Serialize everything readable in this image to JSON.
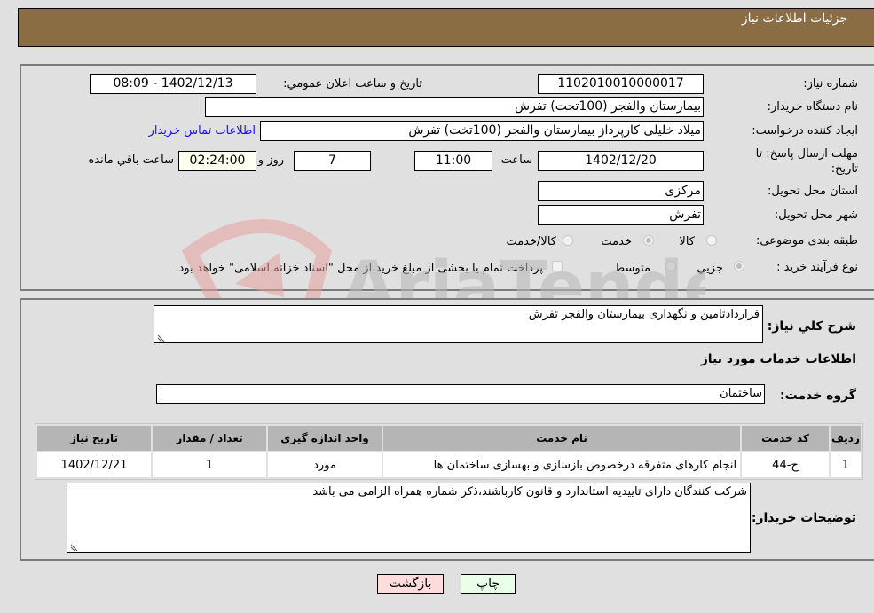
{
  "header": {
    "title": "جزئیات اطلاعات نیاز"
  },
  "fields": {
    "need_number": {
      "label": "شماره نیاز:",
      "value": "1102010010000017"
    },
    "announce_datetime": {
      "label": "تاریخ و ساعت اعلان عمومي:",
      "value": "1402/12/13 - 08:09"
    },
    "buyer_org": {
      "label": "نام دستگاه خریدار:",
      "value": "بیمارستان والفجر (100تخت) تفرش"
    },
    "requester": {
      "label": "ایجاد کننده درخواست:",
      "value": "میلاد خلیلی کارپرداز بیمارستان والفجر (100تخت) تفرش"
    },
    "contact_link": "اطلاعات تماس خریدار",
    "deadline": {
      "label_line1": "مهلت ارسال پاسخ: تا",
      "label_line2": "تاریخ:",
      "date": "1402/12/20",
      "time_label": "ساعت",
      "time": "11:00",
      "days": "7",
      "days_label": "روز و",
      "remaining": "02:24:00",
      "remaining_label": "ساعت باقي مانده"
    },
    "province": {
      "label": "استان محل تحویل:",
      "value": "مرکزی"
    },
    "city": {
      "label": "شهر محل تحویل:",
      "value": "تفرش"
    },
    "category": {
      "label": "طبقه بندی موضوعی:",
      "options": [
        "کالا",
        "خدمت",
        "کالا/خدمت"
      ],
      "selected": "خدمت"
    },
    "purchase_type": {
      "label": "نوع فرآیند خرید :",
      "options": [
        "جزیي",
        "متوسط"
      ],
      "selected": "جزیي",
      "treasury_note": "پرداخت تمام یا بخشی از مبلغ خرید،از محل \"اسناد خزانه اسلامی\" خواهد بود."
    }
  },
  "description": {
    "label": "شرح کلي نیاز:",
    "value": "قراردادتامین و نگهداری بیمارستان والفجر تفرش"
  },
  "services_section": {
    "title": "اطلاعات خدمات مورد نیاز",
    "group_label": "گروه خدمت:",
    "group_value": "ساختمان",
    "table": {
      "headers": [
        "ردیف",
        "کد خدمت",
        "نام خدمت",
        "واحد اندازه گیری",
        "تعداد / مقدار",
        "تاریخ نیاز"
      ],
      "rows": [
        [
          "1",
          "ج-44",
          "انجام کارهای متفرقه درخصوص بازسازی و بهسازی ساختمان ها",
          "مورد",
          "1",
          "1402/12/21"
        ]
      ]
    }
  },
  "buyer_notes": {
    "label": "توضیحات خریدار:",
    "value": "شرکت کنندگان دارای تاییدیه استاندارد و قانون کارباشند،ذکر شماره همراه الزامی می باشد"
  },
  "buttons": {
    "print": "چاپ",
    "back": "بازگشت"
  },
  "colors": {
    "header_bg": "#8b6d43",
    "print_bg": "#eaffea",
    "back_bg": "#ffdcdc",
    "link": "#1a0dff"
  },
  "watermark": "AriaTender.neT"
}
